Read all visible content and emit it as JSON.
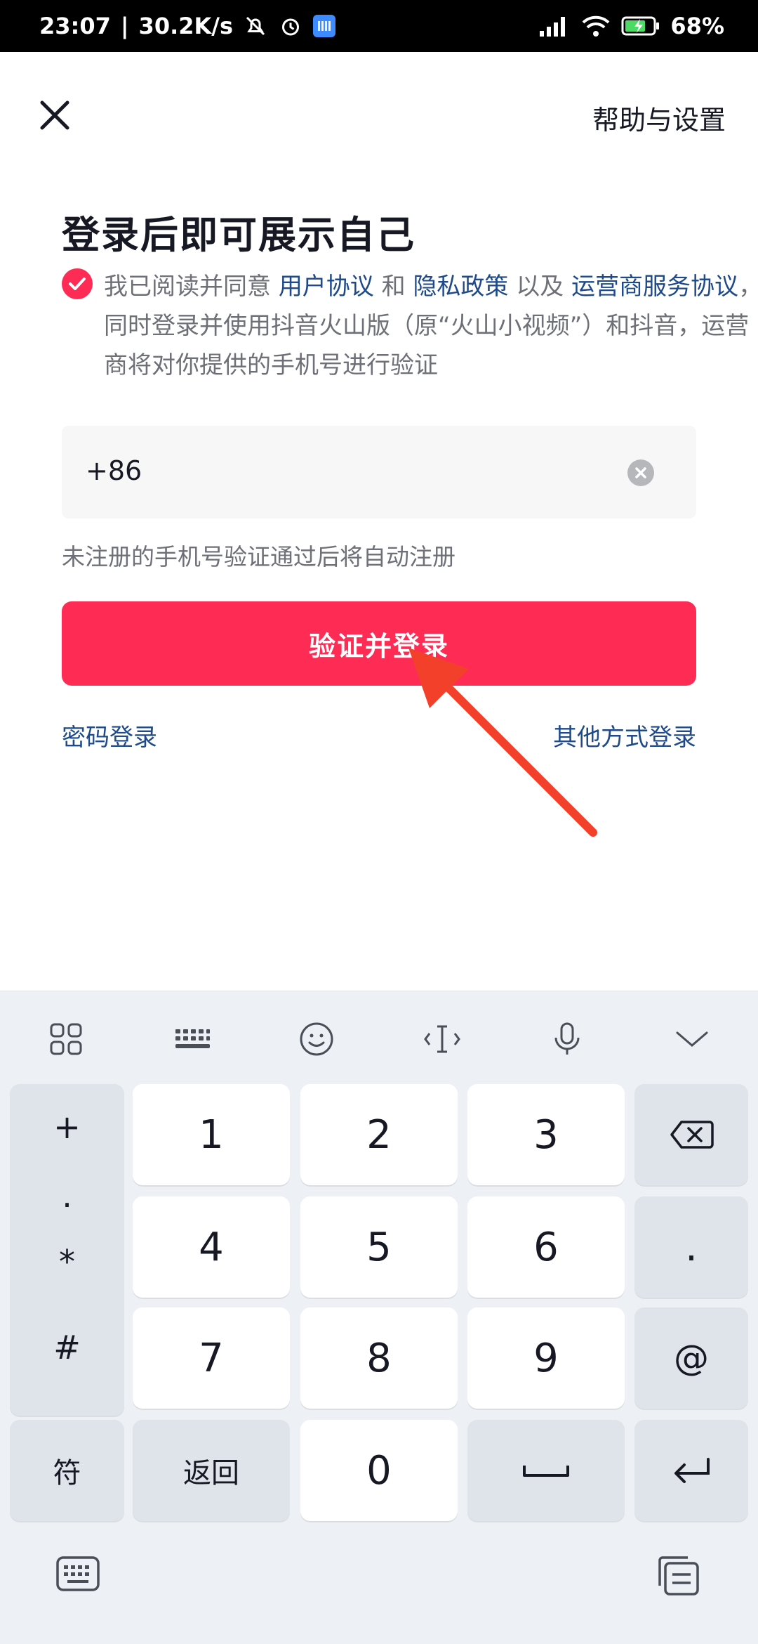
{
  "status_bar": {
    "time": "23:07",
    "speed": "30.2K/s",
    "battery": "68%"
  },
  "header": {
    "help_label": "帮助与设置"
  },
  "title": "登录后即可展示自己",
  "agreement": {
    "checked": true,
    "text1": "我已阅读并同意 ",
    "link_user": "用户协议",
    "text2": " 和 ",
    "link_privacy": "隐私政策",
    "text3": " 以及 ",
    "link_carrier": "运营商服务协议",
    "text4": "，同时登录并使用抖音火山版（原“火山小视频”）和抖音，运营商将对你提供的手机号进行验证"
  },
  "phone": {
    "prefix": "+86"
  },
  "hint": "未注册的手机号验证通过后将自动注册",
  "login_button": "验证并登录",
  "password_login": "密码登录",
  "other_login": "其他方式登录",
  "keyboard": {
    "symbols": [
      "+",
      ".",
      "*",
      "#"
    ],
    "digits": [
      "1",
      "2",
      "3",
      "4",
      "5",
      "6",
      "7",
      "8",
      "9",
      "0"
    ],
    "dot_key": ".",
    "at_key": "@",
    "fu_key": "符",
    "back_key": "返回"
  },
  "colors": {
    "brand": "#fe2c55",
    "link": "#1f4a8a",
    "arrow": "#f2402b"
  }
}
